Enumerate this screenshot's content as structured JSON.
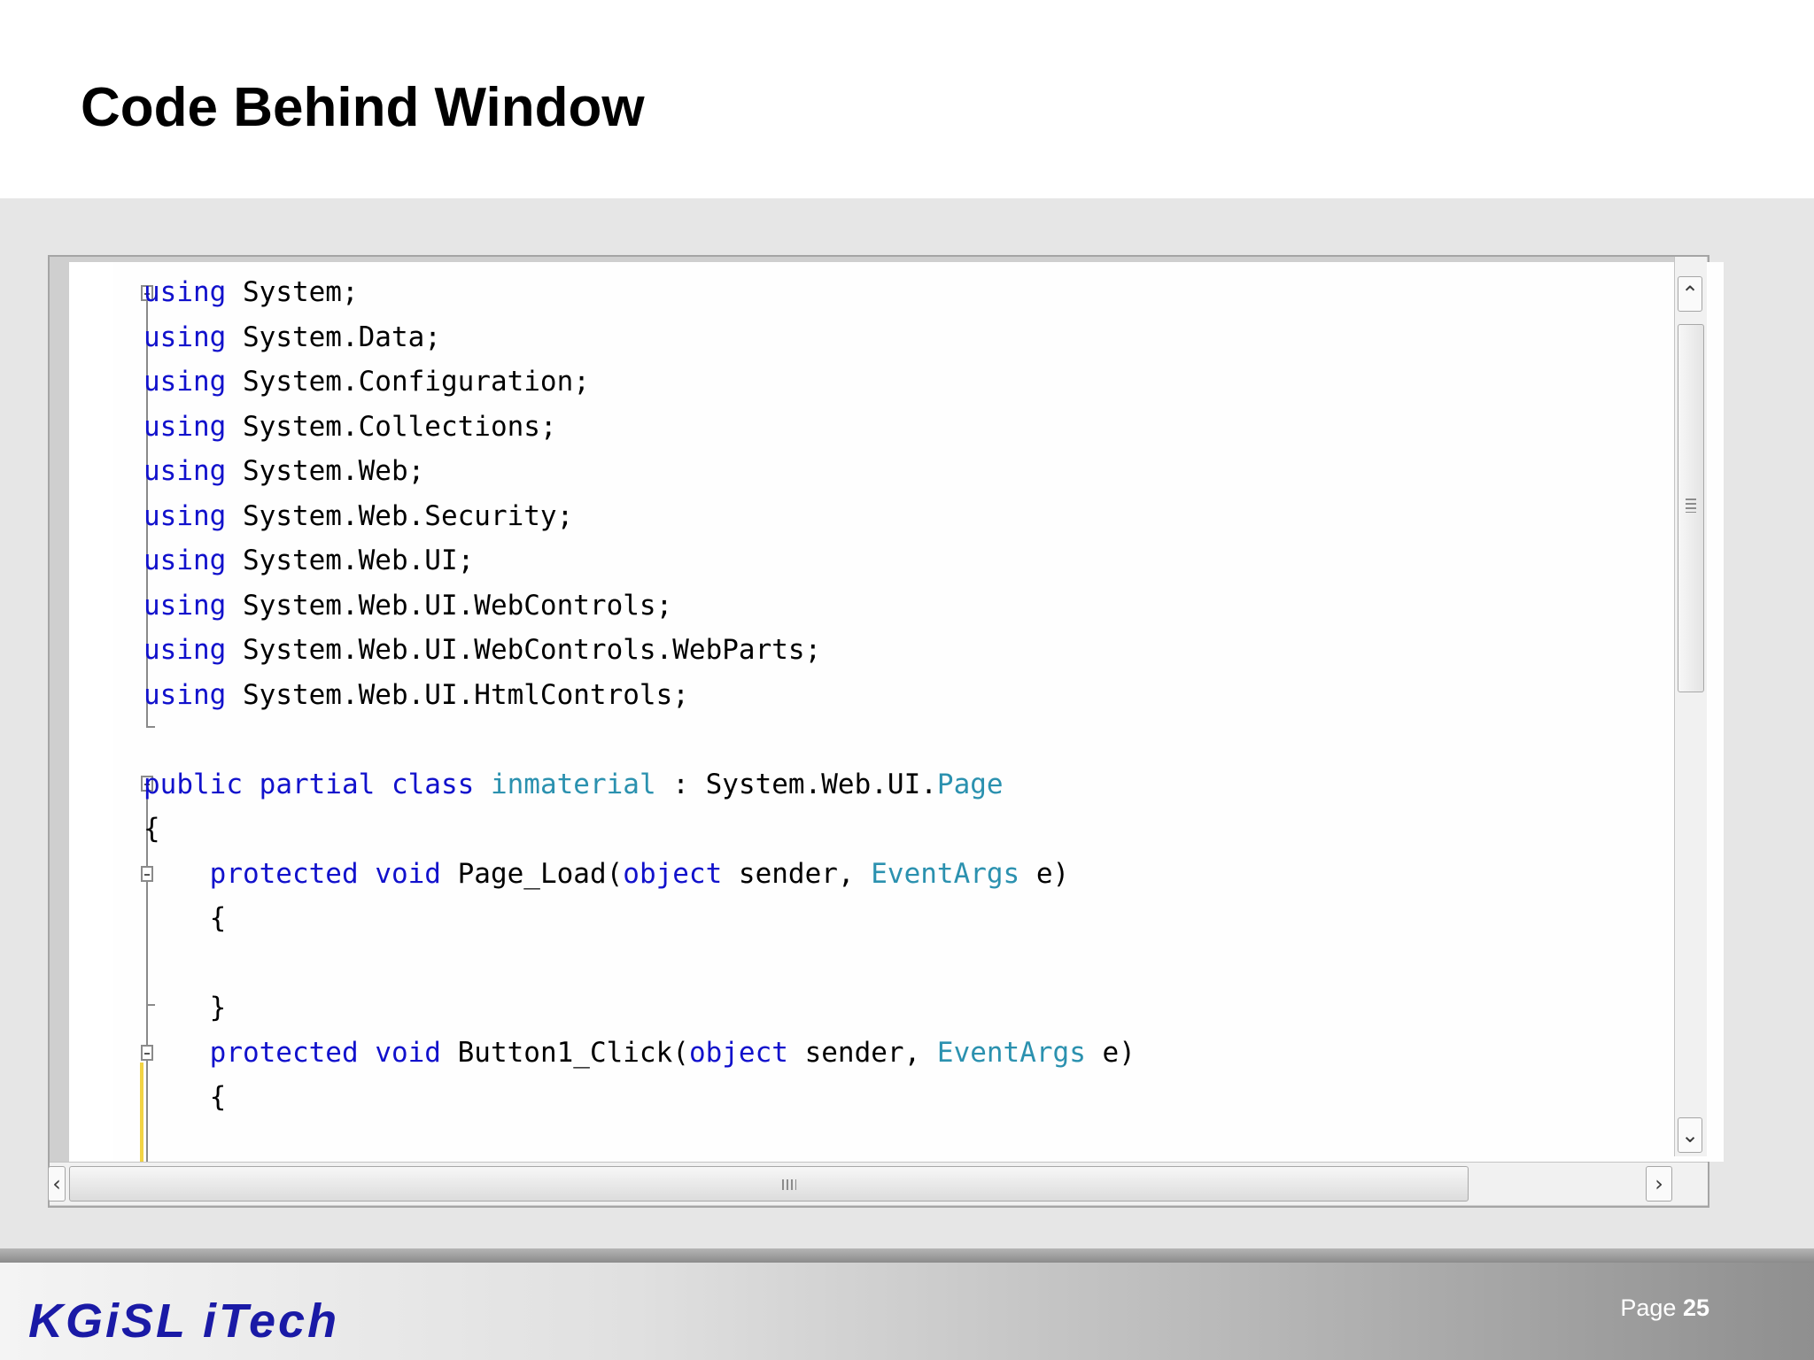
{
  "slide": {
    "title": "Code Behind Window",
    "brand": "KGiSL iTech",
    "page_label": "Page",
    "page_number": "25"
  },
  "editor": {
    "lines": [
      [
        {
          "t": "using",
          "c": "kw"
        },
        {
          "t": " System;",
          "c": "tx"
        }
      ],
      [
        {
          "t": "using",
          "c": "kw"
        },
        {
          "t": " System.Data;",
          "c": "tx"
        }
      ],
      [
        {
          "t": "using",
          "c": "kw"
        },
        {
          "t": " System.Configuration;",
          "c": "tx"
        }
      ],
      [
        {
          "t": "using",
          "c": "kw"
        },
        {
          "t": " System.Collections;",
          "c": "tx"
        }
      ],
      [
        {
          "t": "using",
          "c": "kw"
        },
        {
          "t": " System.Web;",
          "c": "tx"
        }
      ],
      [
        {
          "t": "using",
          "c": "kw"
        },
        {
          "t": " System.Web.Security;",
          "c": "tx"
        }
      ],
      [
        {
          "t": "using",
          "c": "kw"
        },
        {
          "t": " System.Web.UI;",
          "c": "tx"
        }
      ],
      [
        {
          "t": "using",
          "c": "kw"
        },
        {
          "t": " System.Web.UI.WebControls;",
          "c": "tx"
        }
      ],
      [
        {
          "t": "using",
          "c": "kw"
        },
        {
          "t": " System.Web.UI.WebControls.WebParts;",
          "c": "tx"
        }
      ],
      [
        {
          "t": "using",
          "c": "kw"
        },
        {
          "t": " System.Web.UI.HtmlControls;",
          "c": "tx"
        }
      ],
      [],
      [
        {
          "t": "public",
          "c": "kw"
        },
        {
          "t": " ",
          "c": "tx"
        },
        {
          "t": "partial",
          "c": "kw"
        },
        {
          "t": " ",
          "c": "tx"
        },
        {
          "t": "class",
          "c": "kw"
        },
        {
          "t": " ",
          "c": "tx"
        },
        {
          "t": "inmaterial",
          "c": "ty"
        },
        {
          "t": " : System.Web.UI.",
          "c": "tx"
        },
        {
          "t": "Page",
          "c": "ty"
        }
      ],
      [
        {
          "t": "{",
          "c": "tx"
        }
      ],
      [
        {
          "t": "    ",
          "c": "tx"
        },
        {
          "t": "protected",
          "c": "kw"
        },
        {
          "t": " ",
          "c": "tx"
        },
        {
          "t": "void",
          "c": "kw"
        },
        {
          "t": " Page_Load(",
          "c": "tx"
        },
        {
          "t": "object",
          "c": "kw"
        },
        {
          "t": " sender, ",
          "c": "tx"
        },
        {
          "t": "EventArgs",
          "c": "ty"
        },
        {
          "t": " e)",
          "c": "tx"
        }
      ],
      [
        {
          "t": "    {",
          "c": "tx"
        }
      ],
      [],
      [
        {
          "t": "    }",
          "c": "tx"
        }
      ],
      [
        {
          "t": "    ",
          "c": "tx"
        },
        {
          "t": "protected",
          "c": "kw"
        },
        {
          "t": " ",
          "c": "tx"
        },
        {
          "t": "void",
          "c": "kw"
        },
        {
          "t": " Button1_Click(",
          "c": "tx"
        },
        {
          "t": "object",
          "c": "kw"
        },
        {
          "t": " sender, ",
          "c": "tx"
        },
        {
          "t": "EventArgs",
          "c": "ty"
        },
        {
          "t": " e)",
          "c": "tx"
        }
      ],
      [
        {
          "t": "    {",
          "c": "tx"
        }
      ]
    ]
  },
  "scrollbars": {
    "up_icon": "chevron-up-icon",
    "down_icon": "chevron-down-icon",
    "left_icon": "chevron-left-icon",
    "right_icon": "chevron-right-icon"
  },
  "colors": {
    "keyword": "#1111cc",
    "type": "#2b91af",
    "brand": "#1a1aa6"
  }
}
